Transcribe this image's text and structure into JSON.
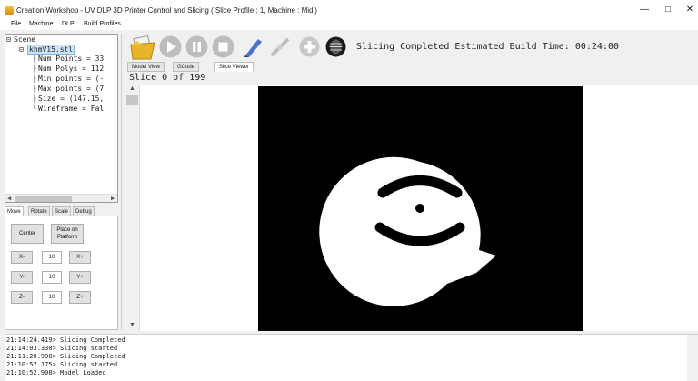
{
  "window": {
    "title": "Creation Workshop - UV DLP 3D Printer Control and Slicing  ( Slice Profile : 1, Machine : Midi)",
    "controls": [
      "—",
      "□",
      "✕"
    ]
  },
  "menu": [
    "File",
    "Machine",
    "DLP",
    "Build Profiles"
  ],
  "tree": {
    "root": "Scene",
    "file": "khmV15.stl",
    "props": [
      "Num Points = 33",
      "Num Polys = 112",
      "Min points = (-",
      "Max points = (7",
      "Size = (147.15,",
      "Wireframe = Fal"
    ]
  },
  "move_tabs": [
    "Move",
    "Rotate",
    "Scale",
    "Debug"
  ],
  "move_panel": {
    "center": "Center",
    "place_on_platform": "Place on Platform",
    "x_minus": "X-",
    "x_plus": "X+",
    "x_value": "10",
    "y_minus": "Y-",
    "y_plus": "Y+",
    "y_value": "10",
    "z_minus": "Z-",
    "z_plus": "Z+",
    "z_value": "10"
  },
  "toolbar": {
    "icons": [
      "open-icon",
      "play-icon",
      "pause-icon",
      "stop-icon",
      "slice-icon",
      "disconnect-icon",
      "add-icon",
      "model-icon"
    ],
    "status": "Slicing Completed Estimated Build Time: 00:24:00"
  },
  "main_tabs": [
    "Model View",
    "GCode",
    "Slice Viewer"
  ],
  "slice": {
    "label": "Slice 0 of 199"
  },
  "log": [
    "21:14:24.419> Slicing Completed",
    "21:14:03.330> Slicing started",
    "21:11:20.998> Slicing Completed",
    "21:10:57.175> Slicing started",
    "21:10:52.908> Model Loaded"
  ],
  "colors": {
    "selection": "#cce4f7",
    "slice_bg": "#000000",
    "slice_fg": "#ffffff"
  }
}
